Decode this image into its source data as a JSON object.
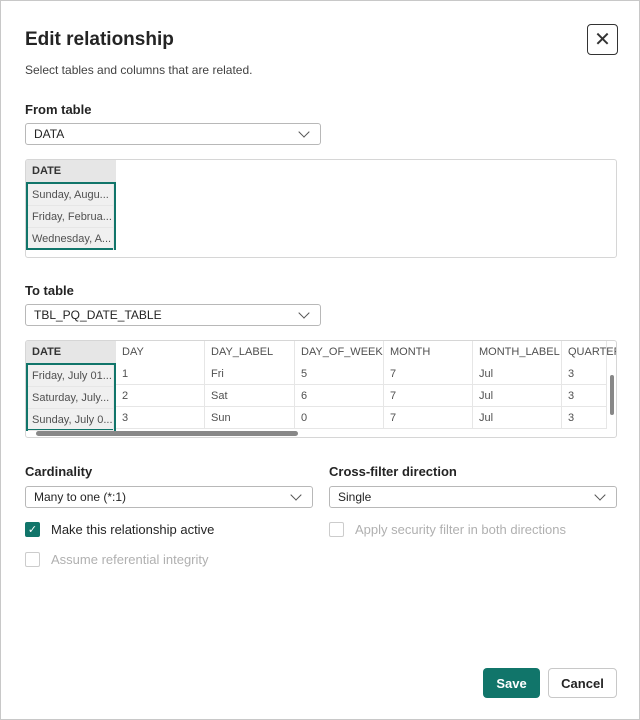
{
  "title": "Edit relationship",
  "subtitle": "Select tables and columns that are related.",
  "from": {
    "label": "From table",
    "value": "DATA",
    "columns": [
      "DATE"
    ],
    "rows": [
      [
        "Sunday, Augu..."
      ],
      [
        "Friday, Februa..."
      ],
      [
        "Wednesday, A..."
      ]
    ]
  },
  "to": {
    "label": "To table",
    "value": "TBL_PQ_DATE_TABLE",
    "columns": [
      "DATE",
      "DAY",
      "DAY_LABEL",
      "DAY_OF_WEEK",
      "MONTH",
      "MONTH_LABEL",
      "QUARTER"
    ],
    "rows": [
      [
        "Friday, July 01...",
        "1",
        "Fri",
        "5",
        "7",
        "Jul",
        "3"
      ],
      [
        "Saturday, July...",
        "2",
        "Sat",
        "6",
        "7",
        "Jul",
        "3"
      ],
      [
        "Sunday, July 0...",
        "3",
        "Sun",
        "0",
        "7",
        "Jul",
        "3"
      ]
    ]
  },
  "cardinality": {
    "label": "Cardinality",
    "value": "Many to one (*:1)"
  },
  "crossfilter": {
    "label": "Cross-filter direction",
    "value": "Single"
  },
  "options": {
    "active": {
      "label": "Make this relationship active",
      "checked": true
    },
    "security": {
      "label": "Apply security filter in both directions",
      "checked": false,
      "disabled": true
    },
    "referential": {
      "label": "Assume referential integrity",
      "checked": false,
      "disabled": true
    }
  },
  "buttons": {
    "save": "Save",
    "cancel": "Cancel"
  },
  "colors": {
    "accent": "#11756a"
  }
}
